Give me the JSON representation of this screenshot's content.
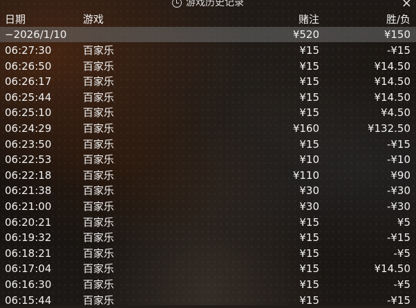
{
  "title": "游戏历史记录",
  "close_icon": "×",
  "columns": {
    "date": "日期",
    "game": "游戏",
    "bet": "赌注",
    "result": "胜/负"
  },
  "summary": {
    "date": "−2026/1/10",
    "bet": "¥520",
    "result": "¥150"
  },
  "rows": [
    {
      "time": "06:27:30",
      "game": "百家乐",
      "bet": "¥15",
      "result": "-¥15"
    },
    {
      "time": "06:26:50",
      "game": "百家乐",
      "bet": "¥15",
      "result": "¥14.50"
    },
    {
      "time": "06:26:17",
      "game": "百家乐",
      "bet": "¥15",
      "result": "¥14.50"
    },
    {
      "time": "06:25:44",
      "game": "百家乐",
      "bet": "¥15",
      "result": "¥14.50"
    },
    {
      "time": "06:25:10",
      "game": "百家乐",
      "bet": "¥15",
      "result": "¥4.50"
    },
    {
      "time": "06:24:29",
      "game": "百家乐",
      "bet": "¥160",
      "result": "¥132.50"
    },
    {
      "time": "06:23:50",
      "game": "百家乐",
      "bet": "¥15",
      "result": "-¥15"
    },
    {
      "time": "06:22:53",
      "game": "百家乐",
      "bet": "¥10",
      "result": "-¥10"
    },
    {
      "time": "06:22:18",
      "game": "百家乐",
      "bet": "¥110",
      "result": "¥90"
    },
    {
      "time": "06:21:38",
      "game": "百家乐",
      "bet": "¥30",
      "result": "-¥30"
    },
    {
      "time": "06:21:00",
      "game": "百家乐",
      "bet": "¥30",
      "result": "-¥30"
    },
    {
      "time": "06:20:21",
      "game": "百家乐",
      "bet": "¥15",
      "result": "¥5"
    },
    {
      "time": "06:19:32",
      "game": "百家乐",
      "bet": "¥15",
      "result": "-¥15"
    },
    {
      "time": "06:18:21",
      "game": "百家乐",
      "bet": "¥15",
      "result": "-¥5"
    },
    {
      "time": "06:17:04",
      "game": "百家乐",
      "bet": "¥15",
      "result": "¥14.50"
    },
    {
      "time": "06:16:30",
      "game": "百家乐",
      "bet": "¥15",
      "result": "-¥5"
    },
    {
      "time": "06:15:44",
      "game": "百家乐",
      "bet": "¥15",
      "result": "-¥15"
    }
  ]
}
